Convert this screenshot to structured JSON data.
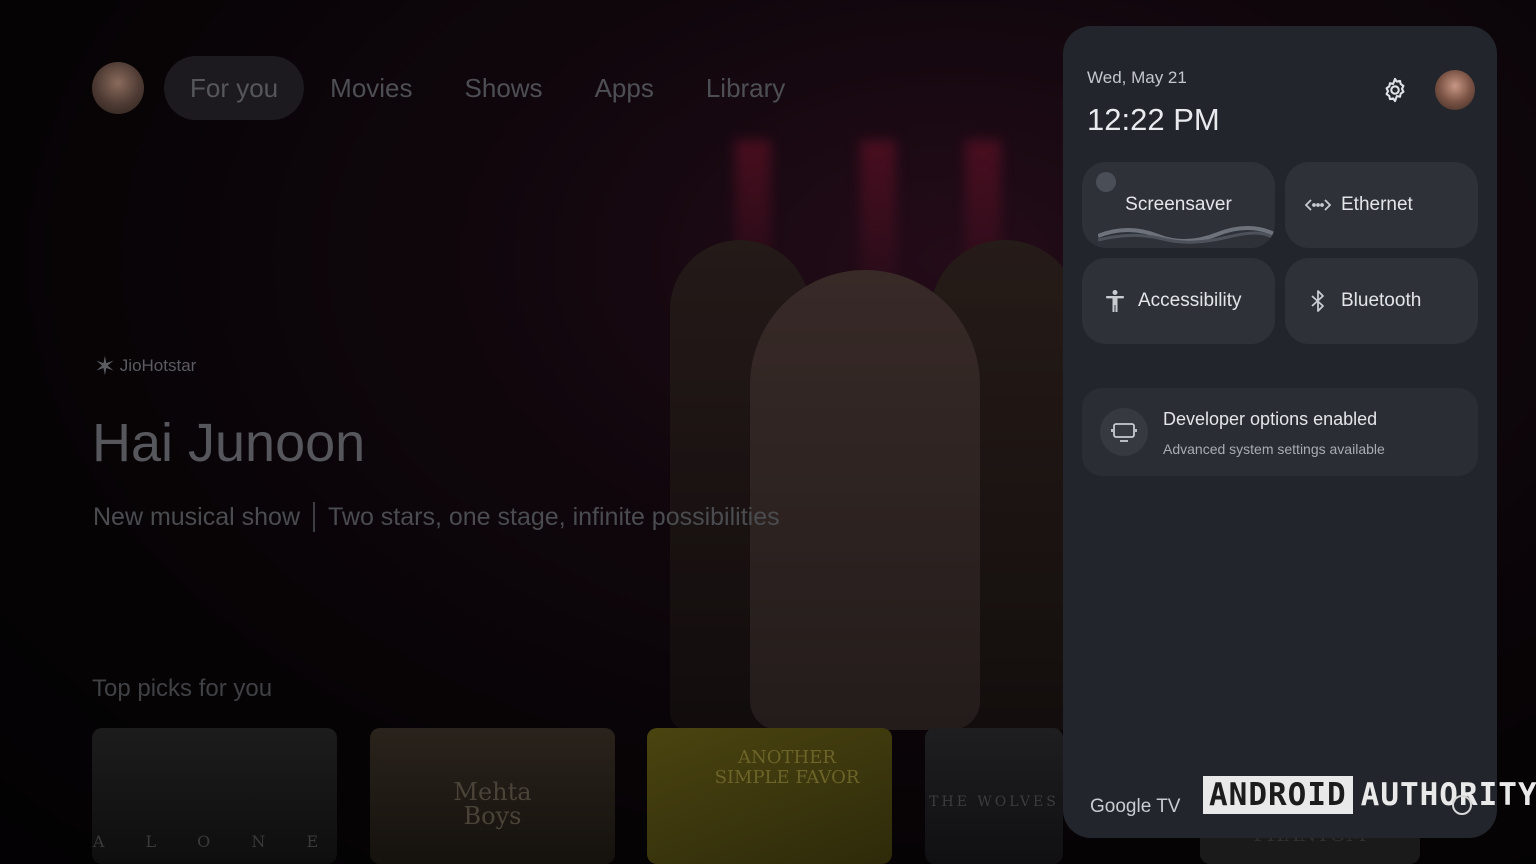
{
  "nav": {
    "tabs": [
      {
        "label": "For you",
        "active": true
      },
      {
        "label": "Movies"
      },
      {
        "label": "Shows"
      },
      {
        "label": "Apps"
      },
      {
        "label": "Library"
      }
    ]
  },
  "hero": {
    "provider": "JioHotstar",
    "title": "Hai Junoon",
    "genre": "New musical show",
    "tagline": "Two stars, one stage, infinite possibilities"
  },
  "row": {
    "title": "Top picks for you",
    "cards": [
      {
        "text": "A L O N E"
      },
      {
        "text": "Mehta Boys"
      },
      {
        "text": "ANOTHER SIMPLE FAVOR"
      },
      {
        "text": "THE WOLVES"
      },
      {
        "text": "PHANTOM"
      }
    ]
  },
  "panel": {
    "date": "Wed, May 21",
    "time": "12:22 PM",
    "tiles": {
      "screensaver": "Screensaver",
      "ethernet": "Ethernet",
      "accessibility": "Accessibility",
      "bluetooth": "Bluetooth"
    },
    "developer": {
      "title": "Developer options enabled",
      "subtitle": "Advanced system settings available"
    },
    "brand": "Google TV",
    "icons": [
      "gear-icon",
      "ethernet-icon",
      "accessibility-icon",
      "bluetooth-icon",
      "developer-icon"
    ]
  },
  "watermark": {
    "left": "ANDROID",
    "right": "AUTHORITY"
  }
}
